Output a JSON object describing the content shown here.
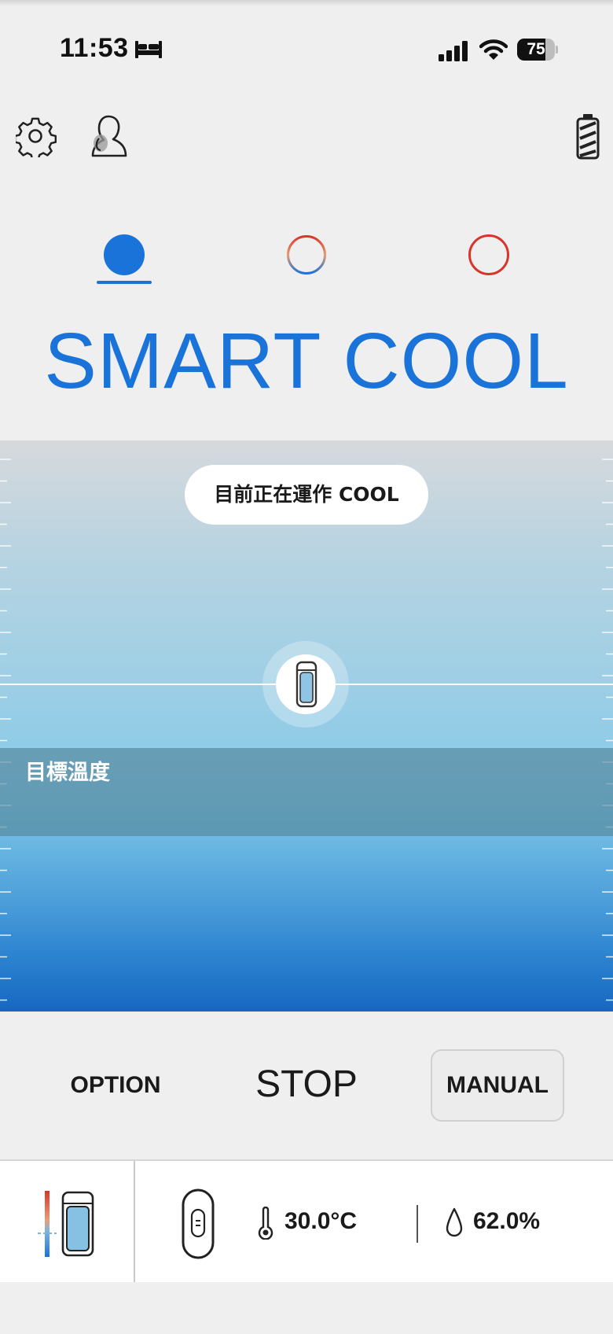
{
  "status_bar": {
    "time": "11:53",
    "battery_level": "75",
    "battery_fraction": 0.75,
    "icons": [
      "bed-icon",
      "signal-icon",
      "wifi-icon",
      "battery-icon"
    ]
  },
  "toolbar": {
    "icons": [
      "gear-icon",
      "profile-icon",
      "device-battery-icon"
    ]
  },
  "modes": {
    "items": [
      {
        "id": "cool",
        "color": "#1a73d9",
        "selected": true
      },
      {
        "id": "smart",
        "colors": [
          "#d9342a",
          "#1a73d9"
        ],
        "selected": false
      },
      {
        "id": "heat",
        "color": "#d9342a",
        "selected": false
      }
    ],
    "title": "SMART COOL",
    "accent_color": "#1a73d9"
  },
  "temperature": {
    "status_text": "目前正在運作 COOL",
    "target_label": "目標溫度"
  },
  "controls": {
    "option_label": "OPTION",
    "stop_label": "STOP",
    "manual_label": "MANUAL"
  },
  "device_panel": {
    "temperature": "30.0°C",
    "humidity": "62.0%",
    "icons": [
      "device-icon",
      "sensor-icon",
      "thermometer-icon",
      "droplet-icon"
    ]
  }
}
